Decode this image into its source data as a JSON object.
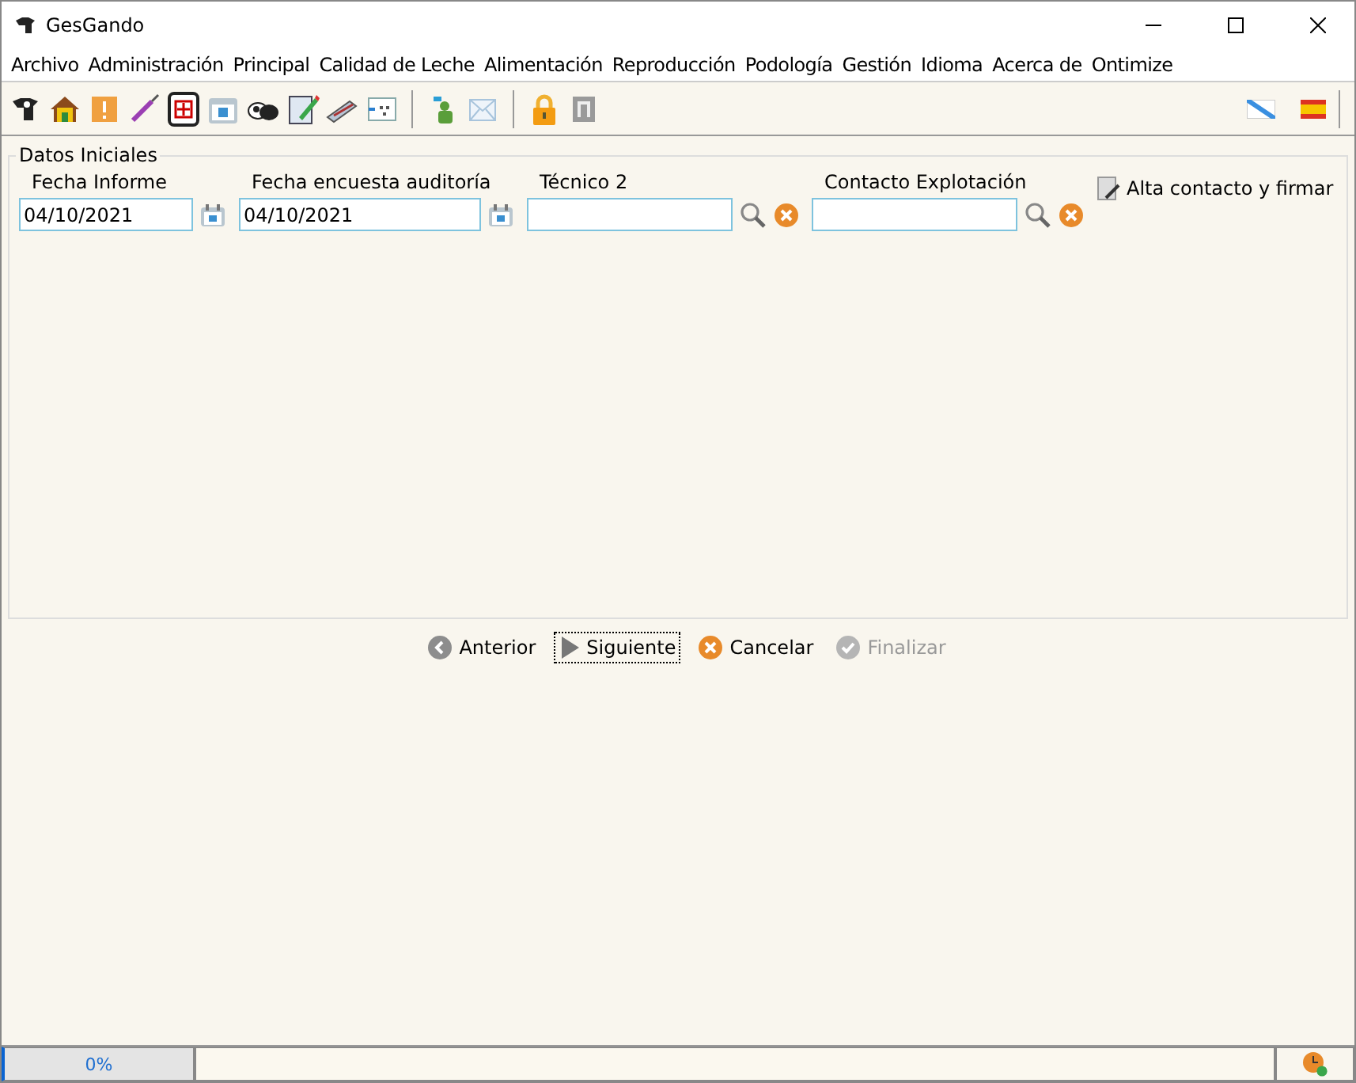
{
  "window": {
    "title": "GesGando"
  },
  "menu": [
    "Archivo",
    "Administración",
    "Principal",
    "Calidad de Leche",
    "Alimentación",
    "Reproducción",
    "Podología",
    "Gestión",
    "Idioma",
    "Acerca de",
    "Ontimize"
  ],
  "panel": {
    "title": "Datos Iniciales",
    "fields": [
      {
        "kind": "date",
        "label": "Fecha Informe",
        "value": "04/10/2021"
      },
      {
        "kind": "date",
        "label": "Fecha encuesta auditoría",
        "value": "04/10/2021"
      },
      {
        "kind": "lookup",
        "label": "Técnico 2"
      },
      {
        "kind": "lookup",
        "label": "Contacto Explotación"
      }
    ],
    "action": "Alta contacto y firmar"
  },
  "buttons": [
    {
      "kind": "back",
      "label": "Anterior",
      "disabled": false,
      "focused": false
    },
    {
      "kind": "next",
      "label": "Siguiente",
      "disabled": false,
      "focused": true
    },
    {
      "kind": "cancel",
      "label": "Cancelar",
      "disabled": false,
      "focused": false
    },
    {
      "kind": "finish",
      "label": "Finalizar",
      "disabled": true,
      "focused": false
    }
  ],
  "status_bar": {
    "progress": {
      "level": 0,
      "reading": "0%"
    }
  }
}
